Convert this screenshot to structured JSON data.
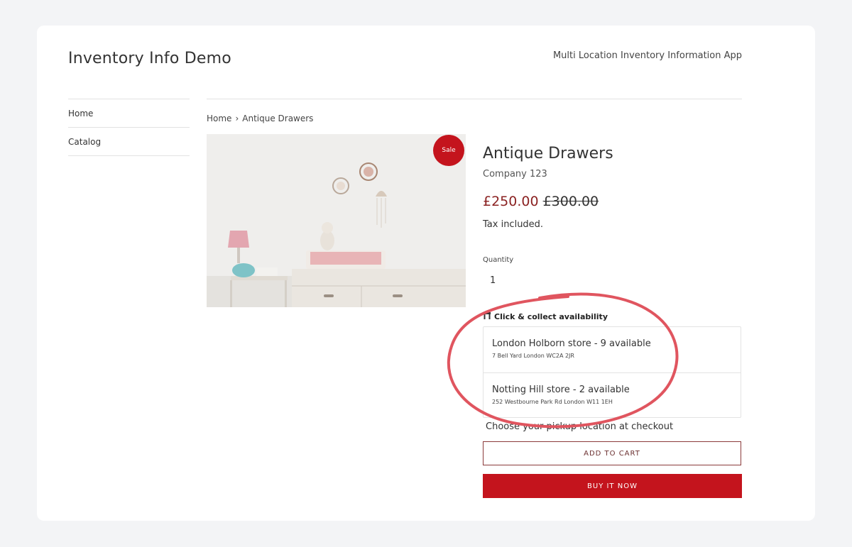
{
  "site": {
    "title": "Inventory Info Demo",
    "tagline": "Multi Location Inventory Information App"
  },
  "sidebar": {
    "items": [
      {
        "label": "Home"
      },
      {
        "label": "Catalog"
      }
    ]
  },
  "breadcrumb": {
    "home": "Home",
    "separator": "›",
    "current": "Antique Drawers"
  },
  "product": {
    "sale_badge": "Sale",
    "title": "Antique Drawers",
    "vendor": "Company 123",
    "price": "£250.00",
    "compare_price": "£300.00",
    "tax_note": "Tax included.",
    "quantity_label": "Quantity",
    "quantity_value": "1"
  },
  "click_collect": {
    "heading": "Click & collect availability",
    "icon": "store-icon",
    "stores": [
      {
        "name": "London Holborn store - 9 available",
        "address": "7 Bell Yard London WC2A 2JR"
      },
      {
        "name": "Notting Hill store - 2 available",
        "address": "252 Westbourne Park Rd London W11 1EH"
      }
    ],
    "pickup_note": "Choose your pickup location at checkout"
  },
  "actions": {
    "add_to_cart": "ADD TO CART",
    "buy_now": "BUY IT NOW"
  },
  "colors": {
    "accent_red": "#c4141d",
    "sale_price": "#8b2222",
    "highlight_circle": "#e0555f"
  }
}
